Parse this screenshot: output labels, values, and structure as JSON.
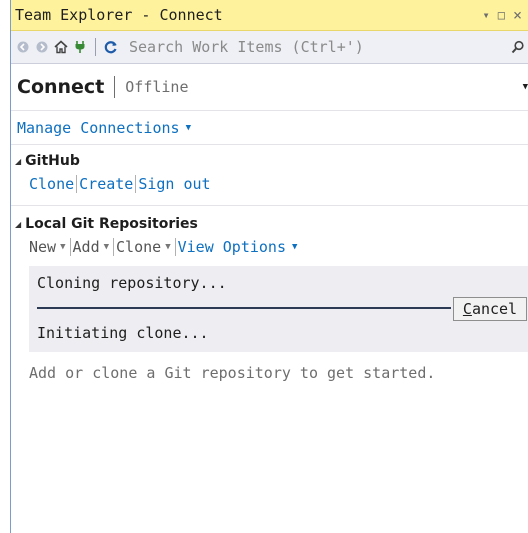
{
  "window": {
    "title": "Team Explorer - Connect",
    "controls": {
      "dropdown": "▾",
      "maximize": "□",
      "close": "×"
    }
  },
  "toolbar": {
    "search_placeholder": "Search Work Items (Ctrl+')",
    "icons": [
      "back-icon",
      "forward-icon",
      "home-icon",
      "plug-icon",
      "refresh-icon",
      "search-icon"
    ]
  },
  "header": {
    "title": "Connect",
    "status": "Offline"
  },
  "manage_connections": {
    "label": "Manage Connections"
  },
  "github": {
    "title": "GitHub",
    "links": [
      {
        "label": "Clone"
      },
      {
        "label": "Create"
      },
      {
        "label": "Sign out"
      }
    ]
  },
  "local_repos": {
    "title": "Local Git Repositories",
    "actions": [
      {
        "label": "New"
      },
      {
        "label": "Add"
      },
      {
        "label": "Clone"
      }
    ],
    "view_options": "View Options",
    "operation": {
      "status": "Cloning repository...",
      "detail": "Initiating clone...",
      "cancel_label": "Cancel"
    },
    "hint": "Add or clone a Git repository to get started."
  },
  "colors": {
    "titlebar_bg": "#fff29d",
    "link": "#0e70c0",
    "toolbar_bg": "#eef0f5",
    "operation_bg": "#eeeef2"
  }
}
